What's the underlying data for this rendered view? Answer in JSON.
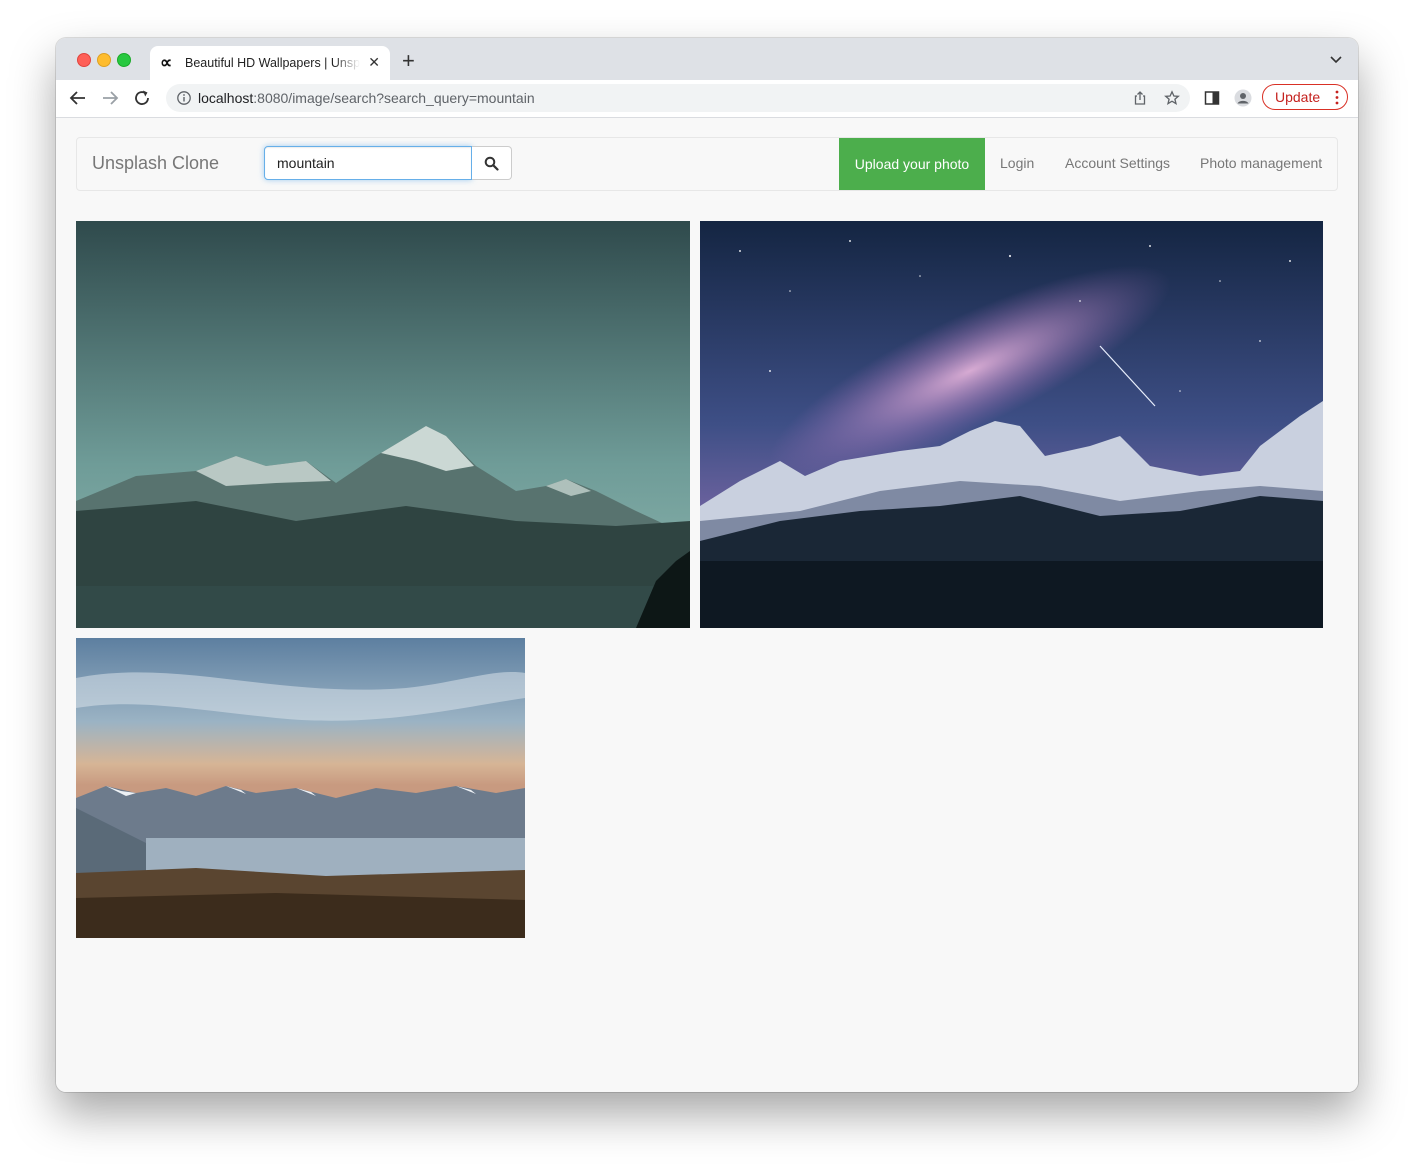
{
  "browser": {
    "tab_title": "Beautiful HD Wallpapers | Unsplash Clone",
    "tab_favicon": "∝",
    "url_host": "localhost",
    "url_rest": ":8080/image/search?search_query=mountain",
    "update_label": "Update",
    "icons": [
      "back-arrow-icon",
      "forward-arrow-icon",
      "reload-icon",
      "site-info-icon",
      "share-icon",
      "bookmark-star-icon",
      "side-panel-icon",
      "profile-icon",
      "more-vert-icon",
      "tab-close-icon",
      "new-tab-icon",
      "tab-search-chevron-icon"
    ]
  },
  "navbar": {
    "brand": "Unsplash Clone",
    "search_value": "mountain",
    "search_icon": "search-icon",
    "upload_label": "Upload your photo",
    "links": [
      "Login",
      "Account Settings",
      "Photo management"
    ],
    "upload_color": "#4cae4c"
  },
  "gallery": {
    "photos": [
      {
        "alt": "teal mountain peaks at dusk"
      },
      {
        "alt": "milky way over snowy mountains"
      },
      {
        "alt": "mountain lake at sunset"
      }
    ]
  }
}
